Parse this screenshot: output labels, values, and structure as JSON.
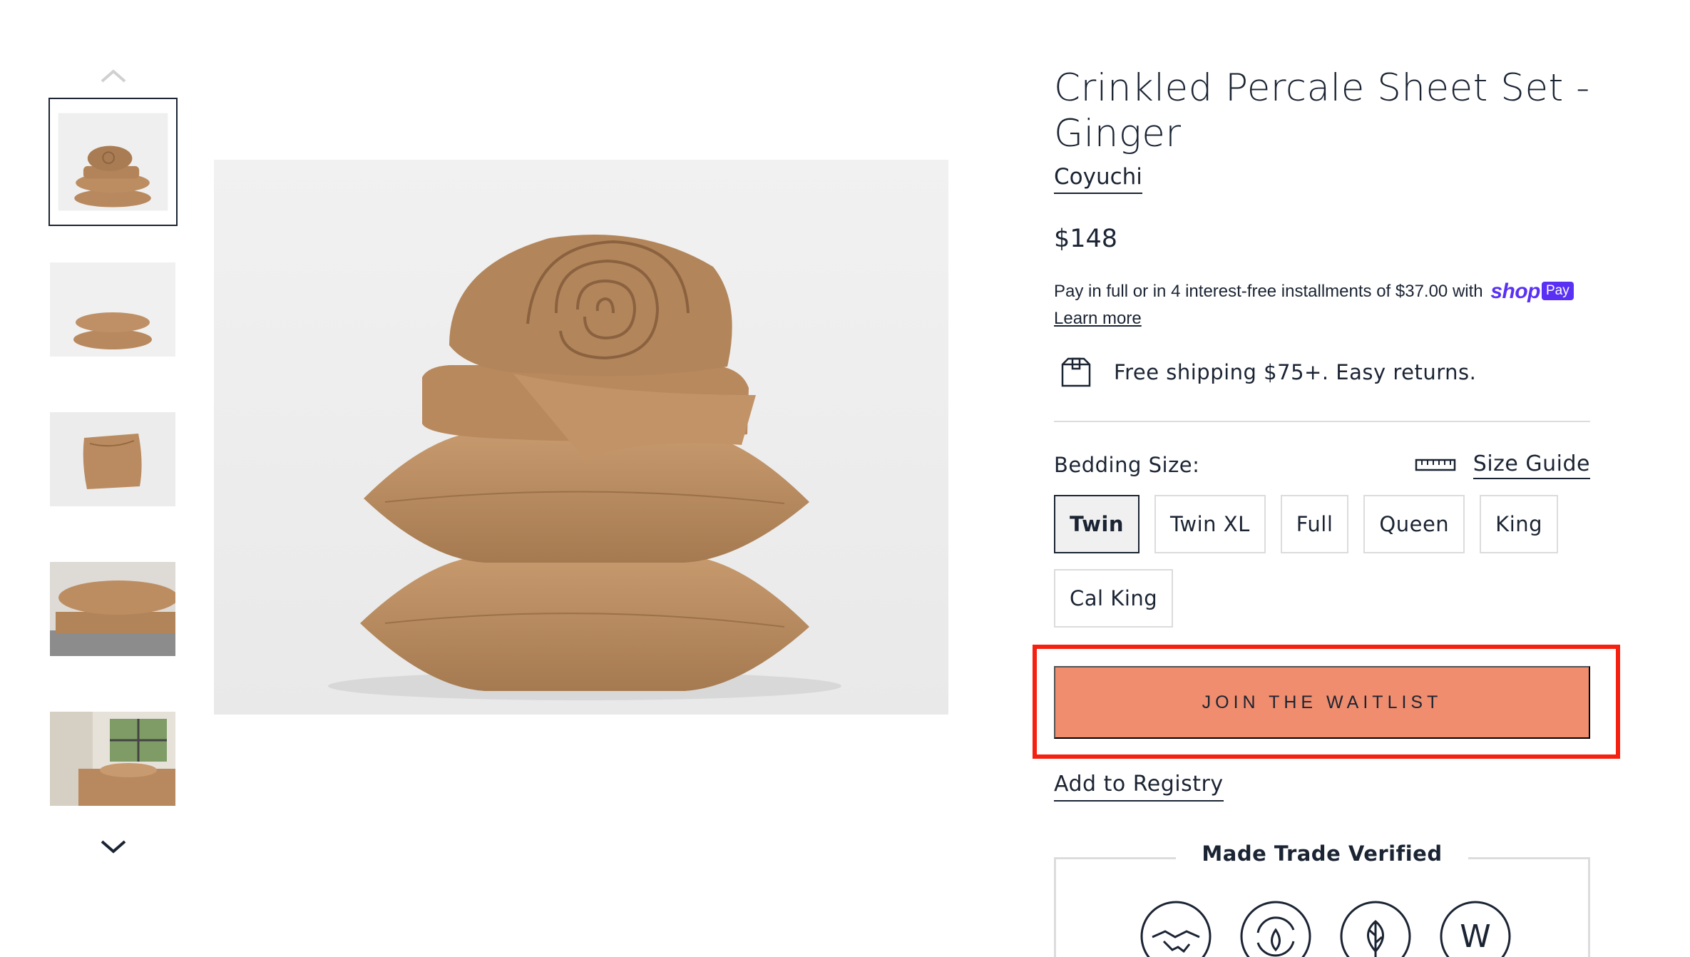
{
  "product": {
    "title": "Crinkled Percale Sheet Set - Ginger",
    "brand": "Coyuchi",
    "price": "$148",
    "installments_text": "Pay in full or in 4 interest-free installments of $37.00 with",
    "shop_logo": "shop",
    "pay_badge": "Pay",
    "learn_more": "Learn more",
    "shipping_text": "Free shipping $75+. Easy returns."
  },
  "size_selector": {
    "label": "Bedding Size:",
    "guide_label": "Size Guide",
    "selected": "Twin",
    "options": [
      "Twin",
      "Twin XL",
      "Full",
      "Queen",
      "King",
      "Cal King"
    ]
  },
  "actions": {
    "waitlist_label": "JOIN THE WAITLIST",
    "registry_label": "Add to Registry"
  },
  "trade": {
    "title": "Made Trade Verified",
    "icons": [
      "handshake-icon",
      "recycle-icon",
      "leaf-icon",
      "w-icon"
    ],
    "w_letter": "W"
  },
  "colors": {
    "accent_button": "#f08d6e",
    "highlight_frame": "#f5200f",
    "text": "#1b2433",
    "shop_pay": "#5a31f4",
    "product": "#b8895f"
  }
}
